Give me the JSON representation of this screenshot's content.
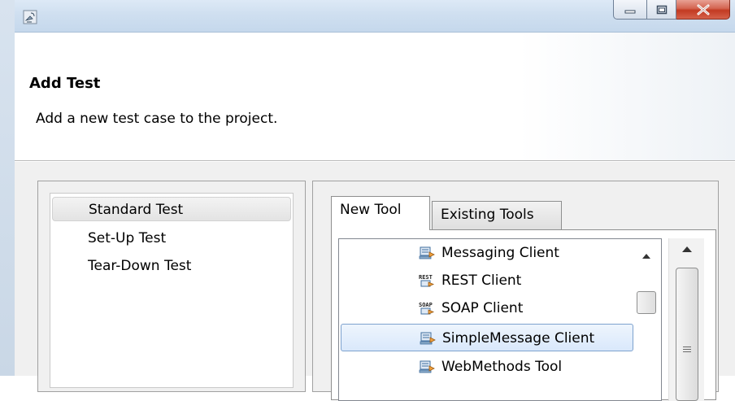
{
  "window": {
    "app_icon": "satellite-dish-icon",
    "buttons": {
      "minimize": "minimize-icon",
      "maximize": "maximize-icon",
      "close": "close-icon"
    }
  },
  "banner": {
    "title": "Add Test",
    "description": "Add a new test case to the project."
  },
  "test_types": [
    {
      "label": "Standard Test",
      "selected": true
    },
    {
      "label": "Set-Up Test",
      "selected": false
    },
    {
      "label": "Tear-Down Test",
      "selected": false
    }
  ],
  "tabs": [
    {
      "label": "New Tool",
      "active": true
    },
    {
      "label": "Existing Tools",
      "active": false
    }
  ],
  "tools": [
    {
      "label": "Messaging Client",
      "icon": "client-icon"
    },
    {
      "label": "REST Client",
      "icon": "rest-icon"
    },
    {
      "label": "SOAP Client",
      "icon": "soap-icon"
    },
    {
      "label": "SimpleMessage Client",
      "icon": "client-icon",
      "selected": true
    },
    {
      "label": "WebMethods Tool",
      "icon": "client-icon"
    }
  ],
  "colors": {
    "selection_border": "#7da2ce",
    "close_button": "#c23a22",
    "titlebar": "#cfdff0"
  }
}
